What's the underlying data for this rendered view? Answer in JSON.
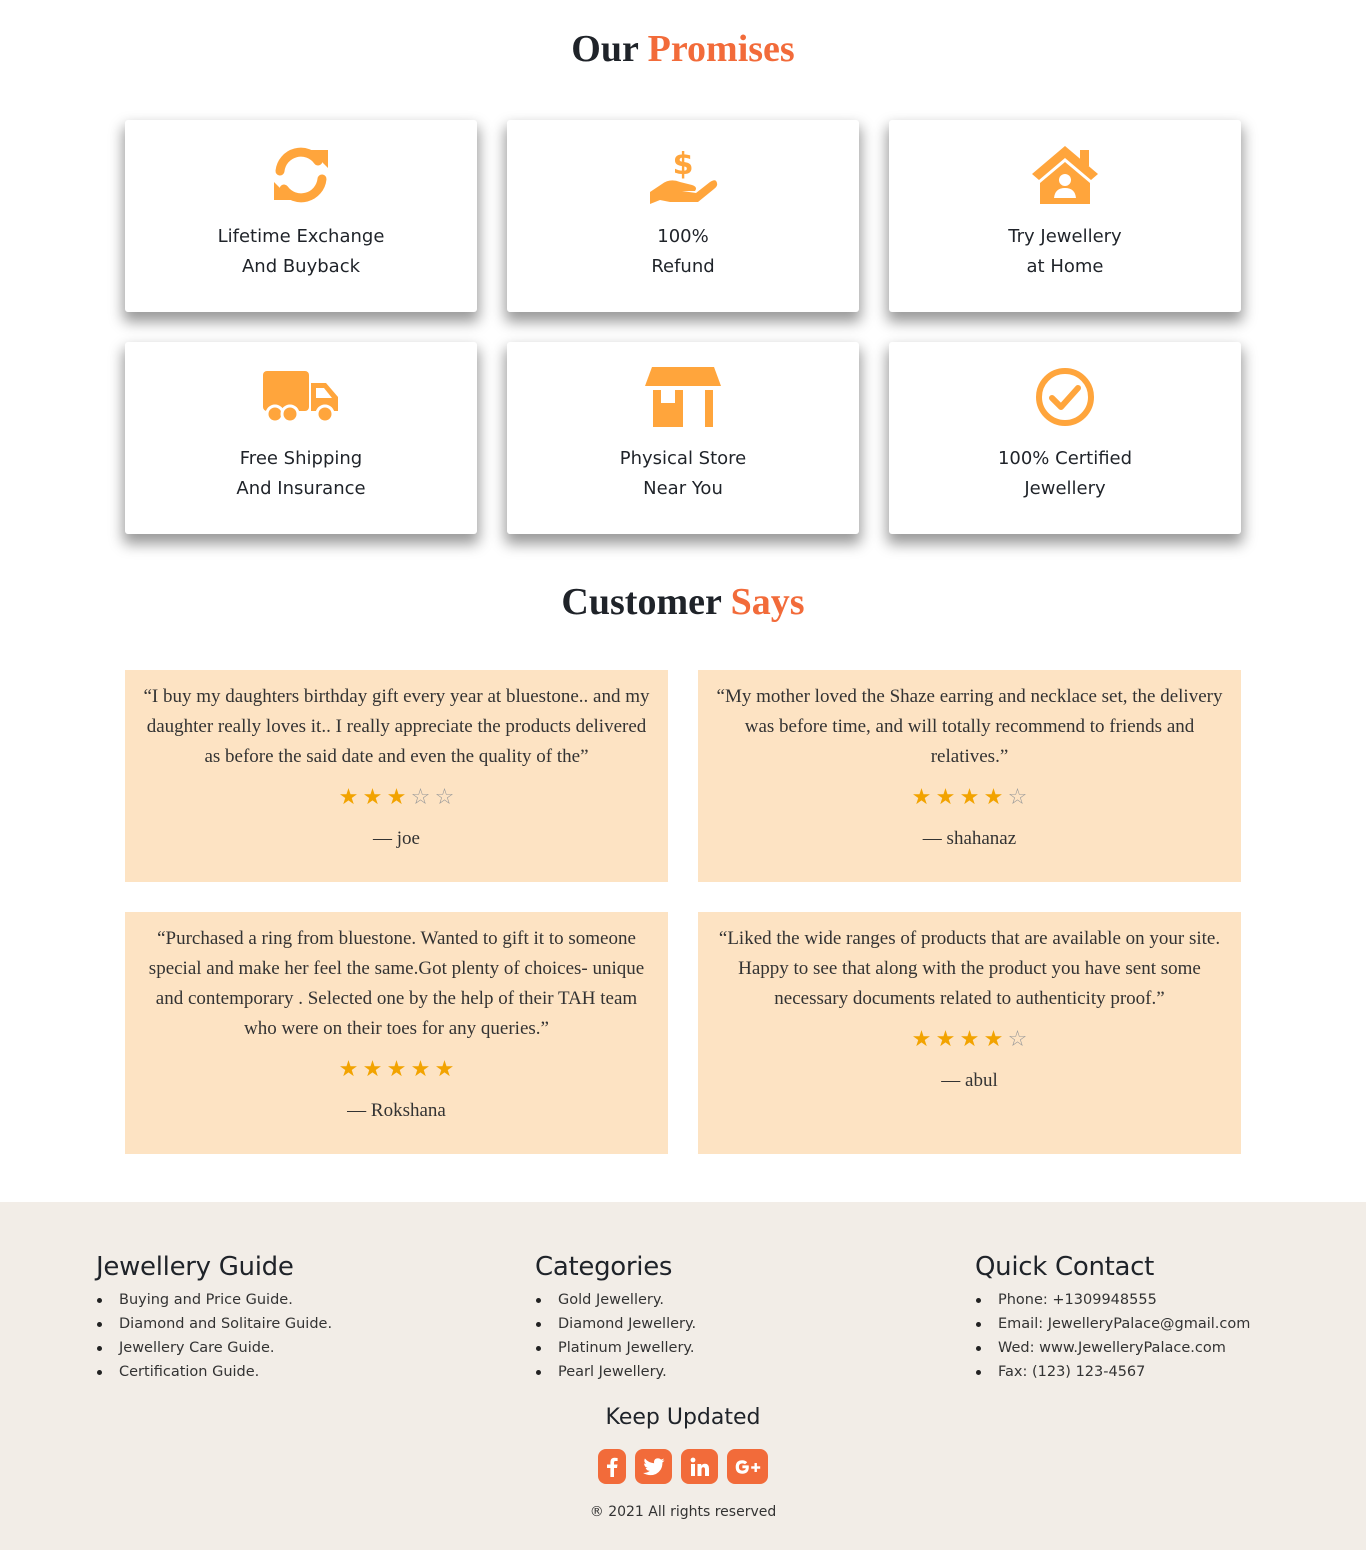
{
  "promises": {
    "title_main": "Our",
    "title_accent": "Promises",
    "items": [
      {
        "line1": "Lifetime Exchange",
        "line2": "And Buyback",
        "icon": "refresh-icon"
      },
      {
        "line1": "100%",
        "line2": "Refund",
        "icon": "hand-dollar-icon"
      },
      {
        "line1": "Try Jewellery",
        "line2": "at Home",
        "icon": "house-user-icon"
      },
      {
        "line1": "Free Shipping",
        "line2": "And Insurance",
        "icon": "truck-icon"
      },
      {
        "line1": "Physical Store",
        "line2": "Near You",
        "icon": "store-icon"
      },
      {
        "line1": "100% Certified",
        "line2": "Jewellery",
        "icon": "check-circle-icon"
      }
    ]
  },
  "reviews": {
    "title_main": "Customer",
    "title_accent": "Says",
    "items": [
      {
        "quote": "“I buy my daughters birthday gift every year at bluestone.. and my daughter really loves it.. I really appreciate the products delivered as before the said date and even the quality of the”",
        "rating": 3,
        "author": "— joe"
      },
      {
        "quote": "“My mother loved the Shaze earring and necklace set, the delivery was before time, and will totally recommend to friends and relatives.”",
        "rating": 4,
        "author": "— shahanaz"
      },
      {
        "quote": "“Purchased a ring from bluestone. Wanted to gift it to someone special and make her feel the same.Got plenty of choices- unique and contemporary . Selected one by the help of their TAH team who were on their toes for any queries.”",
        "rating": 5,
        "author": "— Rokshana"
      },
      {
        "quote": "“Liked the wide ranges of products that are available on your site. Happy to see that along with the product you have sent some necessary documents related to authenticity proof.”",
        "rating": 4,
        "author": "— abul"
      }
    ]
  },
  "footer": {
    "guide": {
      "title": "Jewellery Guide",
      "items": [
        "Buying and Price Guide.",
        "Diamond and Solitaire Guide.",
        "Jewellery Care Guide.",
        "Certification Guide."
      ]
    },
    "categories": {
      "title": "Categories",
      "items": [
        "Gold Jewellery.",
        "Diamond Jewellery.",
        "Platinum Jewellery.",
        "Pearl Jewellery."
      ]
    },
    "contact": {
      "title": "Quick Contact",
      "items": [
        "Phone: +1309948555",
        "Email: JewelleryPalace@gmail.com",
        "Wed: www.JewelleryPalace.com",
        "Fax: (123) 123-4567"
      ]
    },
    "keep_updated": "Keep Updated",
    "socials": [
      "facebook-icon",
      "twitter-icon",
      "linkedin-icon",
      "google-plus-icon"
    ],
    "copyright": "® 2021 All rights reserved"
  },
  "colors": {
    "accent": "#f26b3a",
    "icon_orange": "#ffa53c",
    "review_bg": "#fde3c3",
    "star": "#f2a300",
    "footer_bg": "#f2ede7"
  }
}
